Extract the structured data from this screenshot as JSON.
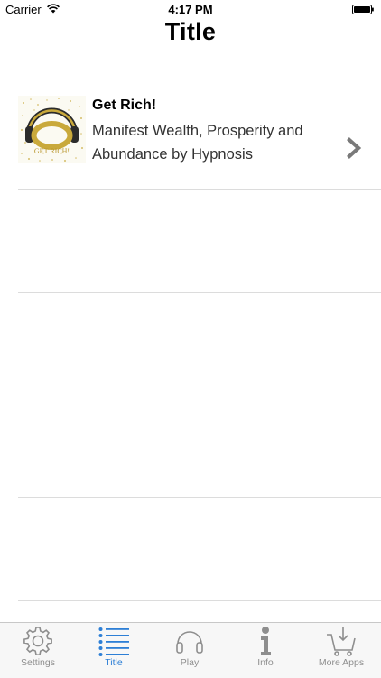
{
  "status_bar": {
    "carrier": "Carrier",
    "time": "4:17 PM"
  },
  "nav": {
    "title": "Title"
  },
  "list": {
    "items": [
      {
        "title": "Get Rich!",
        "subtitle": "Manifest Wealth, Prosperity and Abundance by Hypnosis",
        "thumb_text": "GET RICH!"
      }
    ]
  },
  "tab_bar": {
    "active_color": "#2d7fd6",
    "inactive_color": "#8e8e8e",
    "tabs": [
      {
        "label": "Settings",
        "icon": "gear-icon"
      },
      {
        "label": "Title",
        "icon": "list-icon",
        "active": true
      },
      {
        "label": "Play",
        "icon": "headphones-icon"
      },
      {
        "label": "Info",
        "icon": "info-icon"
      },
      {
        "label": "More Apps",
        "icon": "download-cart-icon"
      }
    ]
  }
}
